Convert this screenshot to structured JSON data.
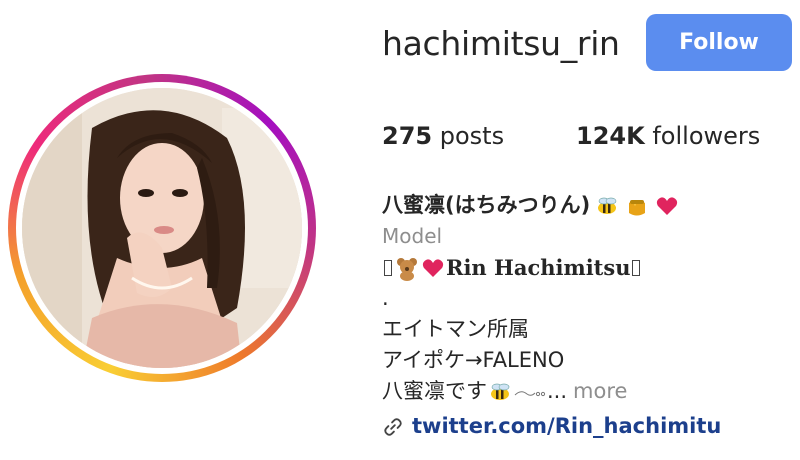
{
  "profile": {
    "username": "hachimitsu_rin",
    "follow_label": "Follow",
    "posts_count": "275",
    "posts_label": "posts",
    "followers_count": "124K",
    "followers_label": "followers"
  },
  "bio": {
    "display_name": "八蜜凛(はちみつりん)",
    "category": "Model",
    "line1_name": "Rin Hachimitsu",
    "line2": ".",
    "line3": "エイトマン所属",
    "line4": "アイポケ→FALENO",
    "line5": "八蜜凛です",
    "line5_tail": "...",
    "more_label": "more",
    "link_text": "twitter.com/Rin_hachimitu"
  },
  "icons": {
    "bee": "bee-emoji",
    "honey": "honey-pot-emoji",
    "heart": "red-heart-emoji",
    "bear": "teddy-bear-emoji",
    "link": "link-icon"
  },
  "colors": {
    "follow_bg": "#5b8def",
    "link": "#1c3f8c",
    "muted": "#8e8e8e",
    "heart": "#e0245e"
  }
}
